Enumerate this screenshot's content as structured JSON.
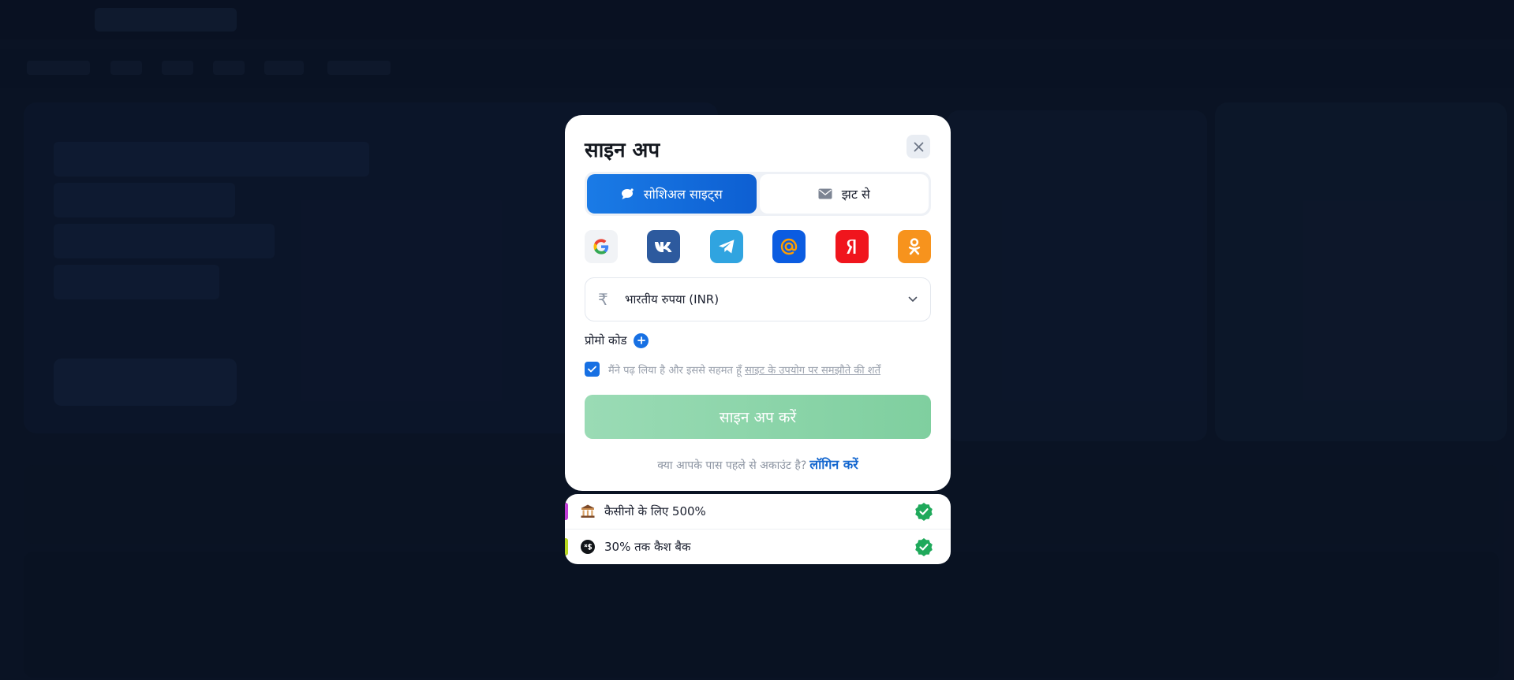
{
  "modal": {
    "title": "साइन अप",
    "tabs": [
      {
        "label": "सोशिअल साइट्स",
        "icon": "chat-bubble-icon",
        "active": true
      },
      {
        "label": "झट से",
        "icon": "envelope-icon",
        "active": false
      }
    ],
    "social_providers": [
      {
        "name": "google",
        "icon": "google-icon"
      },
      {
        "name": "vk",
        "icon": "vk-icon"
      },
      {
        "name": "telegram",
        "icon": "telegram-icon"
      },
      {
        "name": "mailru",
        "icon": "mailru-at-icon"
      },
      {
        "name": "yandex",
        "icon": "yandex-icon"
      },
      {
        "name": "odnoklassniki",
        "icon": "ok-icon"
      }
    ],
    "currency": {
      "symbol": "₹",
      "label": "भारतीय रुपया (INR)"
    },
    "promo": {
      "label": "प्रोमो कोड"
    },
    "terms": {
      "text": "मैंने पढ़ लिया है और इससे सहमत हूँ",
      "link": "साइट के उपयोग पर समझौते की शर्तें",
      "checked": true
    },
    "submit_label": "साइन अप करें",
    "login": {
      "prompt": "क्या आपके पास पहले से अकाउंट है?",
      "link": "लॉगिन करें"
    }
  },
  "bonuses": [
    {
      "label": "कैसीनो के लिए 500%",
      "icon": "casino-icon",
      "accent": "#c03bd6"
    },
    {
      "label": "30% तक कैश बैक",
      "icon": "cashback-icon",
      "accent": "#b7d71f"
    }
  ],
  "colors": {
    "primary": "#1770e3",
    "submit": "#8fd6ac",
    "success_badge": "#1fa95b"
  }
}
